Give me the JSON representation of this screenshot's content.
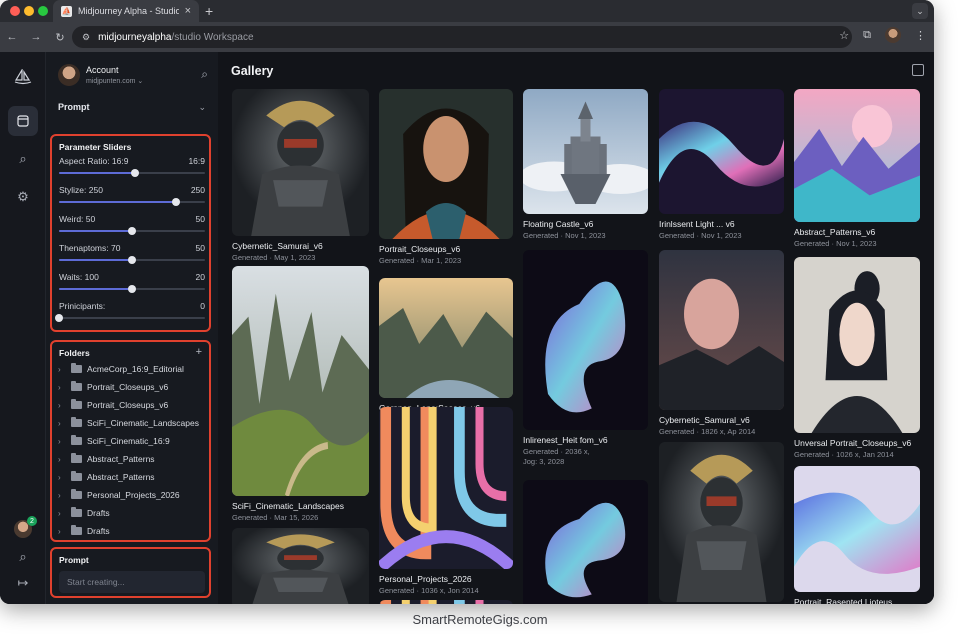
{
  "browser": {
    "tab_title": "Midjourney Alpha - Studio W",
    "url_host": "midjourneyalpha",
    "url_path": "/studio Workspace",
    "colors": {
      "close": "#ff5f57",
      "minimize": "#febc2e",
      "maximize": "#28c840"
    }
  },
  "sidebar": {
    "account_name": "Account",
    "account_email": "midjpunten.com",
    "prompt_section": "Prompt",
    "params_title": "Parameter Sliders",
    "sliders": [
      {
        "label": "Aspect Ratio: 16:9",
        "value_text": "16:9",
        "level": 0.52
      },
      {
        "label": "Stylize: 250",
        "value_text": "250",
        "level": 0.8
      },
      {
        "label": "Weird: 50",
        "value_text": "50",
        "level": 0.5
      },
      {
        "label": "Thenaptoms: 70",
        "value_text": "50",
        "level": 0.5
      },
      {
        "label": "Waits: 100",
        "value_text": "20",
        "level": 0.5
      },
      {
        "label": "Prinicipants:",
        "value_text": "0",
        "level": 0.0
      }
    ],
    "folders_title": "Folders",
    "folders": [
      "AcmeCorp_16:9_Editorial",
      "Portrait_Closeups_v6",
      "Portrait_Closeups_v6",
      "SciFi_Cinematic_Landscapes",
      "SciFi_Cinematic_16:9",
      "Abstract_Patterns",
      "Abstract_Patterns",
      "Personal_Projects_2026",
      "Drafts",
      "Drafts"
    ],
    "prompt_title": "Prompt",
    "prompt_placeholder": "Start creating...",
    "notification_count": "2"
  },
  "gallery": {
    "title": "Gallery",
    "items": [
      {
        "title": "Cybernetic_Samurai_v6",
        "meta": "Generated · May 1, 2023",
        "icon": "samurai-image"
      },
      {
        "title": "Portrait_Closeups_v6",
        "meta": "Generated · Mar 1, 2023",
        "icon": "portrait-image"
      },
      {
        "title": "Floating Castle_v6",
        "meta": "Generated · Nov 1, 2023",
        "icon": "castle-image"
      },
      {
        "title": "Irinlssent Light ... v6",
        "meta": "Generated · Nov 1, 2023",
        "icon": "iridescent-image"
      },
      {
        "title": "Abstract_Patterns_v6",
        "meta": "Generated · Nov 1, 2023",
        "icon": "mountains-image"
      },
      {
        "title": "SciFi_Cinematic_Landscapes",
        "meta": "Generated · Mar 15, 2026",
        "icon": "cliffs-image"
      },
      {
        "title": "Garnnan_Leno:Saoses_v6",
        "meta": "Generated · Thitev, Jun 11, 2026",
        "icon": "valley-image"
      },
      {
        "title": "Inlirenest_Heit fom_v6",
        "meta": "Generated · 2036 x,",
        "meta2": "Jog: 3, 2028",
        "icon": "holographic-image"
      },
      {
        "title": "Cybernetic_Samural_v6",
        "meta": "Generated · 1826 x, Ap 2014",
        "icon": "moon-image"
      },
      {
        "title": "Unversal Portrait_Closeups_v6",
        "meta": "Generated · 1026 x, Jan 2014",
        "icon": "anime-portrait-image"
      },
      {
        "title": "Personal_Projects_2026",
        "meta": "Generated · 1036 x, Jon 2014",
        "icon": "pattern-image"
      },
      {
        "title": "Portrait_Rasented Lioteus",
        "meta": "",
        "icon": "ribbon-image"
      }
    ]
  },
  "watermark": "SmartRemoteGigs.com"
}
